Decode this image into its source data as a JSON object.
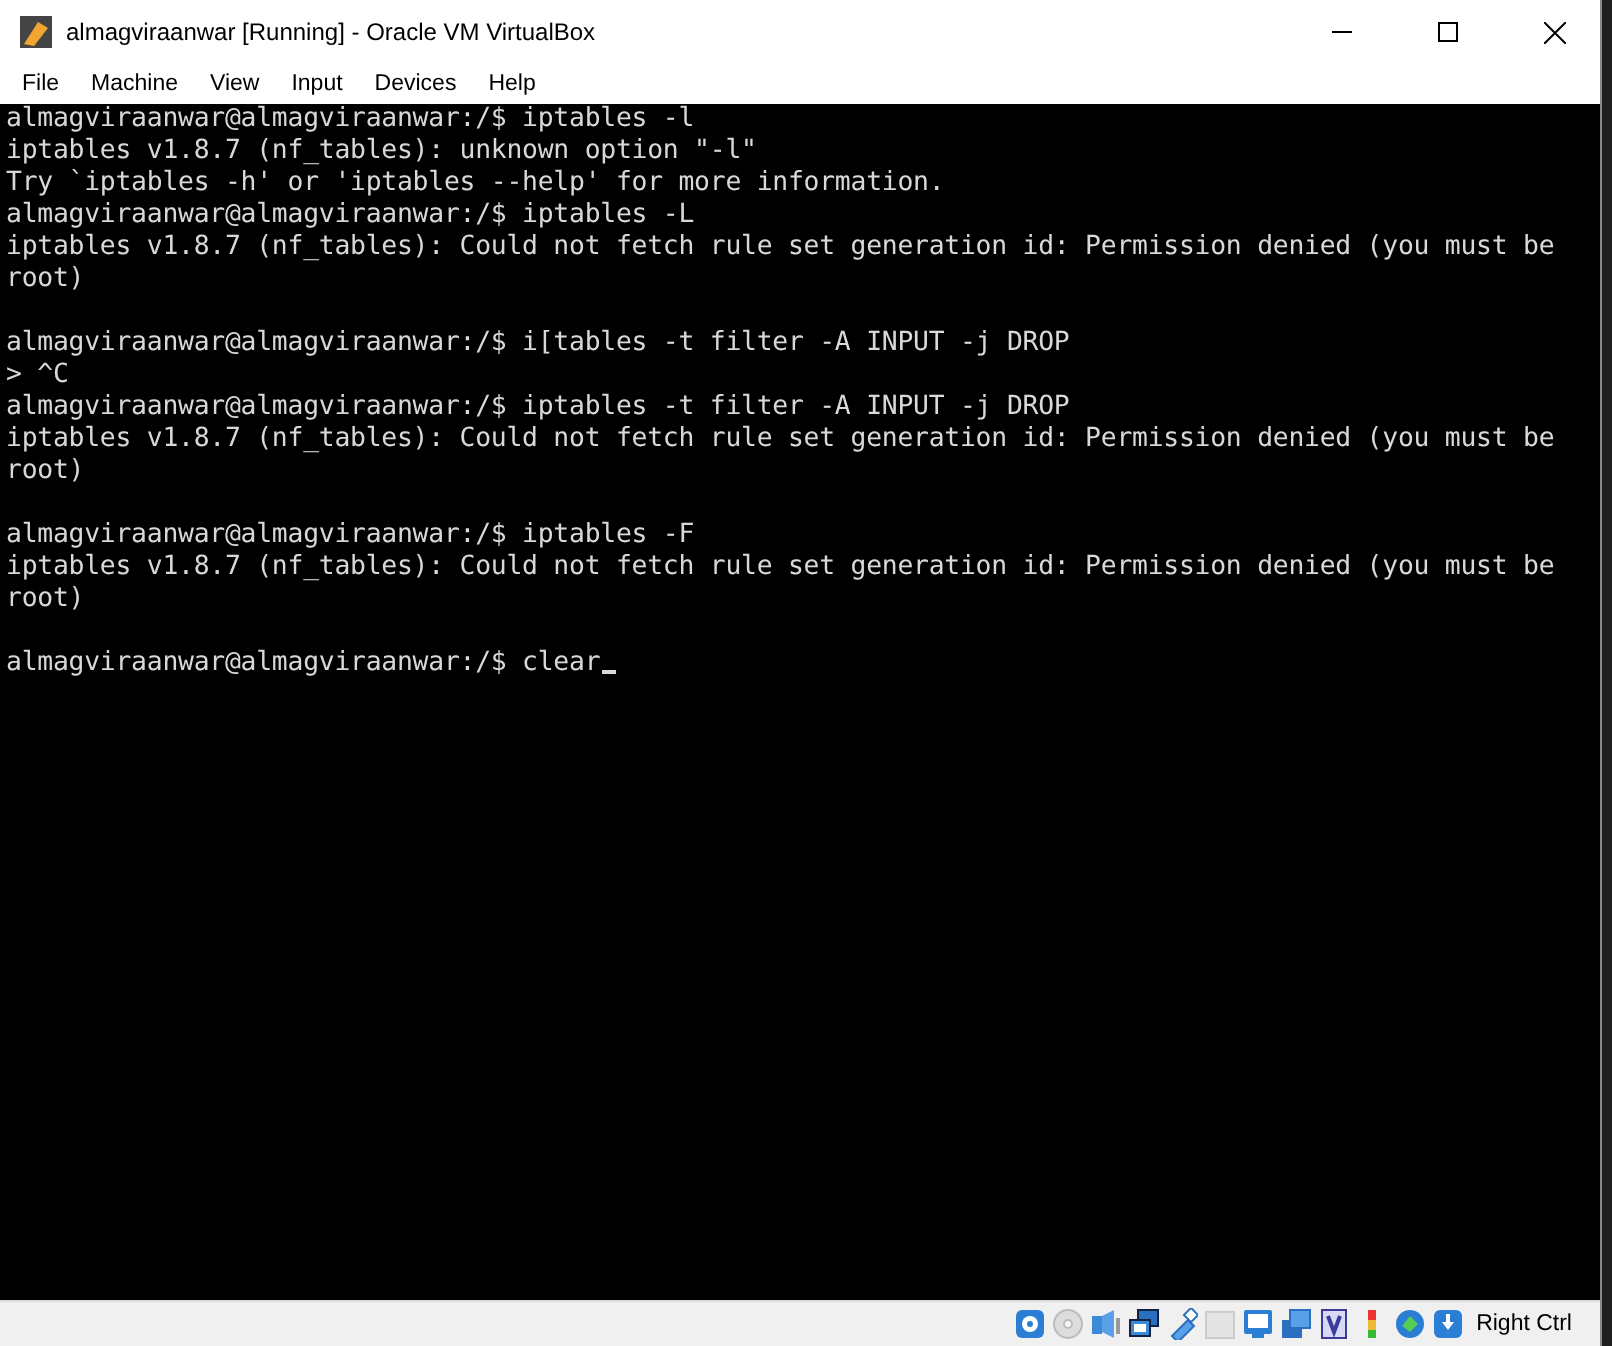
{
  "window": {
    "title": "almagviraanwar [Running] - Oracle VM VirtualBox"
  },
  "menu": [
    "File",
    "Machine",
    "View",
    "Input",
    "Devices",
    "Help"
  ],
  "terminal": {
    "lines": [
      {
        "kind": "text",
        "text": "almagviraanwar@almagviraanwar:/$ iptables -l"
      },
      {
        "kind": "text",
        "text": "iptables v1.8.7 (nf_tables): unknown option \"-l\""
      },
      {
        "kind": "text",
        "text": "Try `iptables -h' or 'iptables --help' for more information."
      },
      {
        "kind": "text",
        "text": "almagviraanwar@almagviraanwar:/$ iptables -L"
      },
      {
        "kind": "text",
        "text": "iptables v1.8.7 (nf_tables): Could not fetch rule set generation id: Permission denied (you must be"
      },
      {
        "kind": "text",
        "text": "root)"
      },
      {
        "kind": "blank"
      },
      {
        "kind": "text",
        "text": "almagviraanwar@almagviraanwar:/$ i[tables -t filter -A INPUT -j DROP"
      },
      {
        "kind": "text",
        "text": "> ^C"
      },
      {
        "kind": "text",
        "text": "almagviraanwar@almagviraanwar:/$ iptables -t filter -A INPUT -j DROP"
      },
      {
        "kind": "text",
        "text": "iptables v1.8.7 (nf_tables): Could not fetch rule set generation id: Permission denied (you must be"
      },
      {
        "kind": "text",
        "text": "root)"
      },
      {
        "kind": "blank"
      },
      {
        "kind": "text",
        "text": "almagviraanwar@almagviraanwar:/$ iptables -F"
      },
      {
        "kind": "text",
        "text": "iptables v1.8.7 (nf_tables): Could not fetch rule set generation id: Permission denied (you must be"
      },
      {
        "kind": "text",
        "text": "root)"
      },
      {
        "kind": "blank"
      },
      {
        "kind": "text",
        "text": "almagviraanwar@almagviraanwar:/$ clear",
        "cursor": true
      }
    ]
  },
  "status_bar": {
    "host_key": "Right Ctrl"
  }
}
